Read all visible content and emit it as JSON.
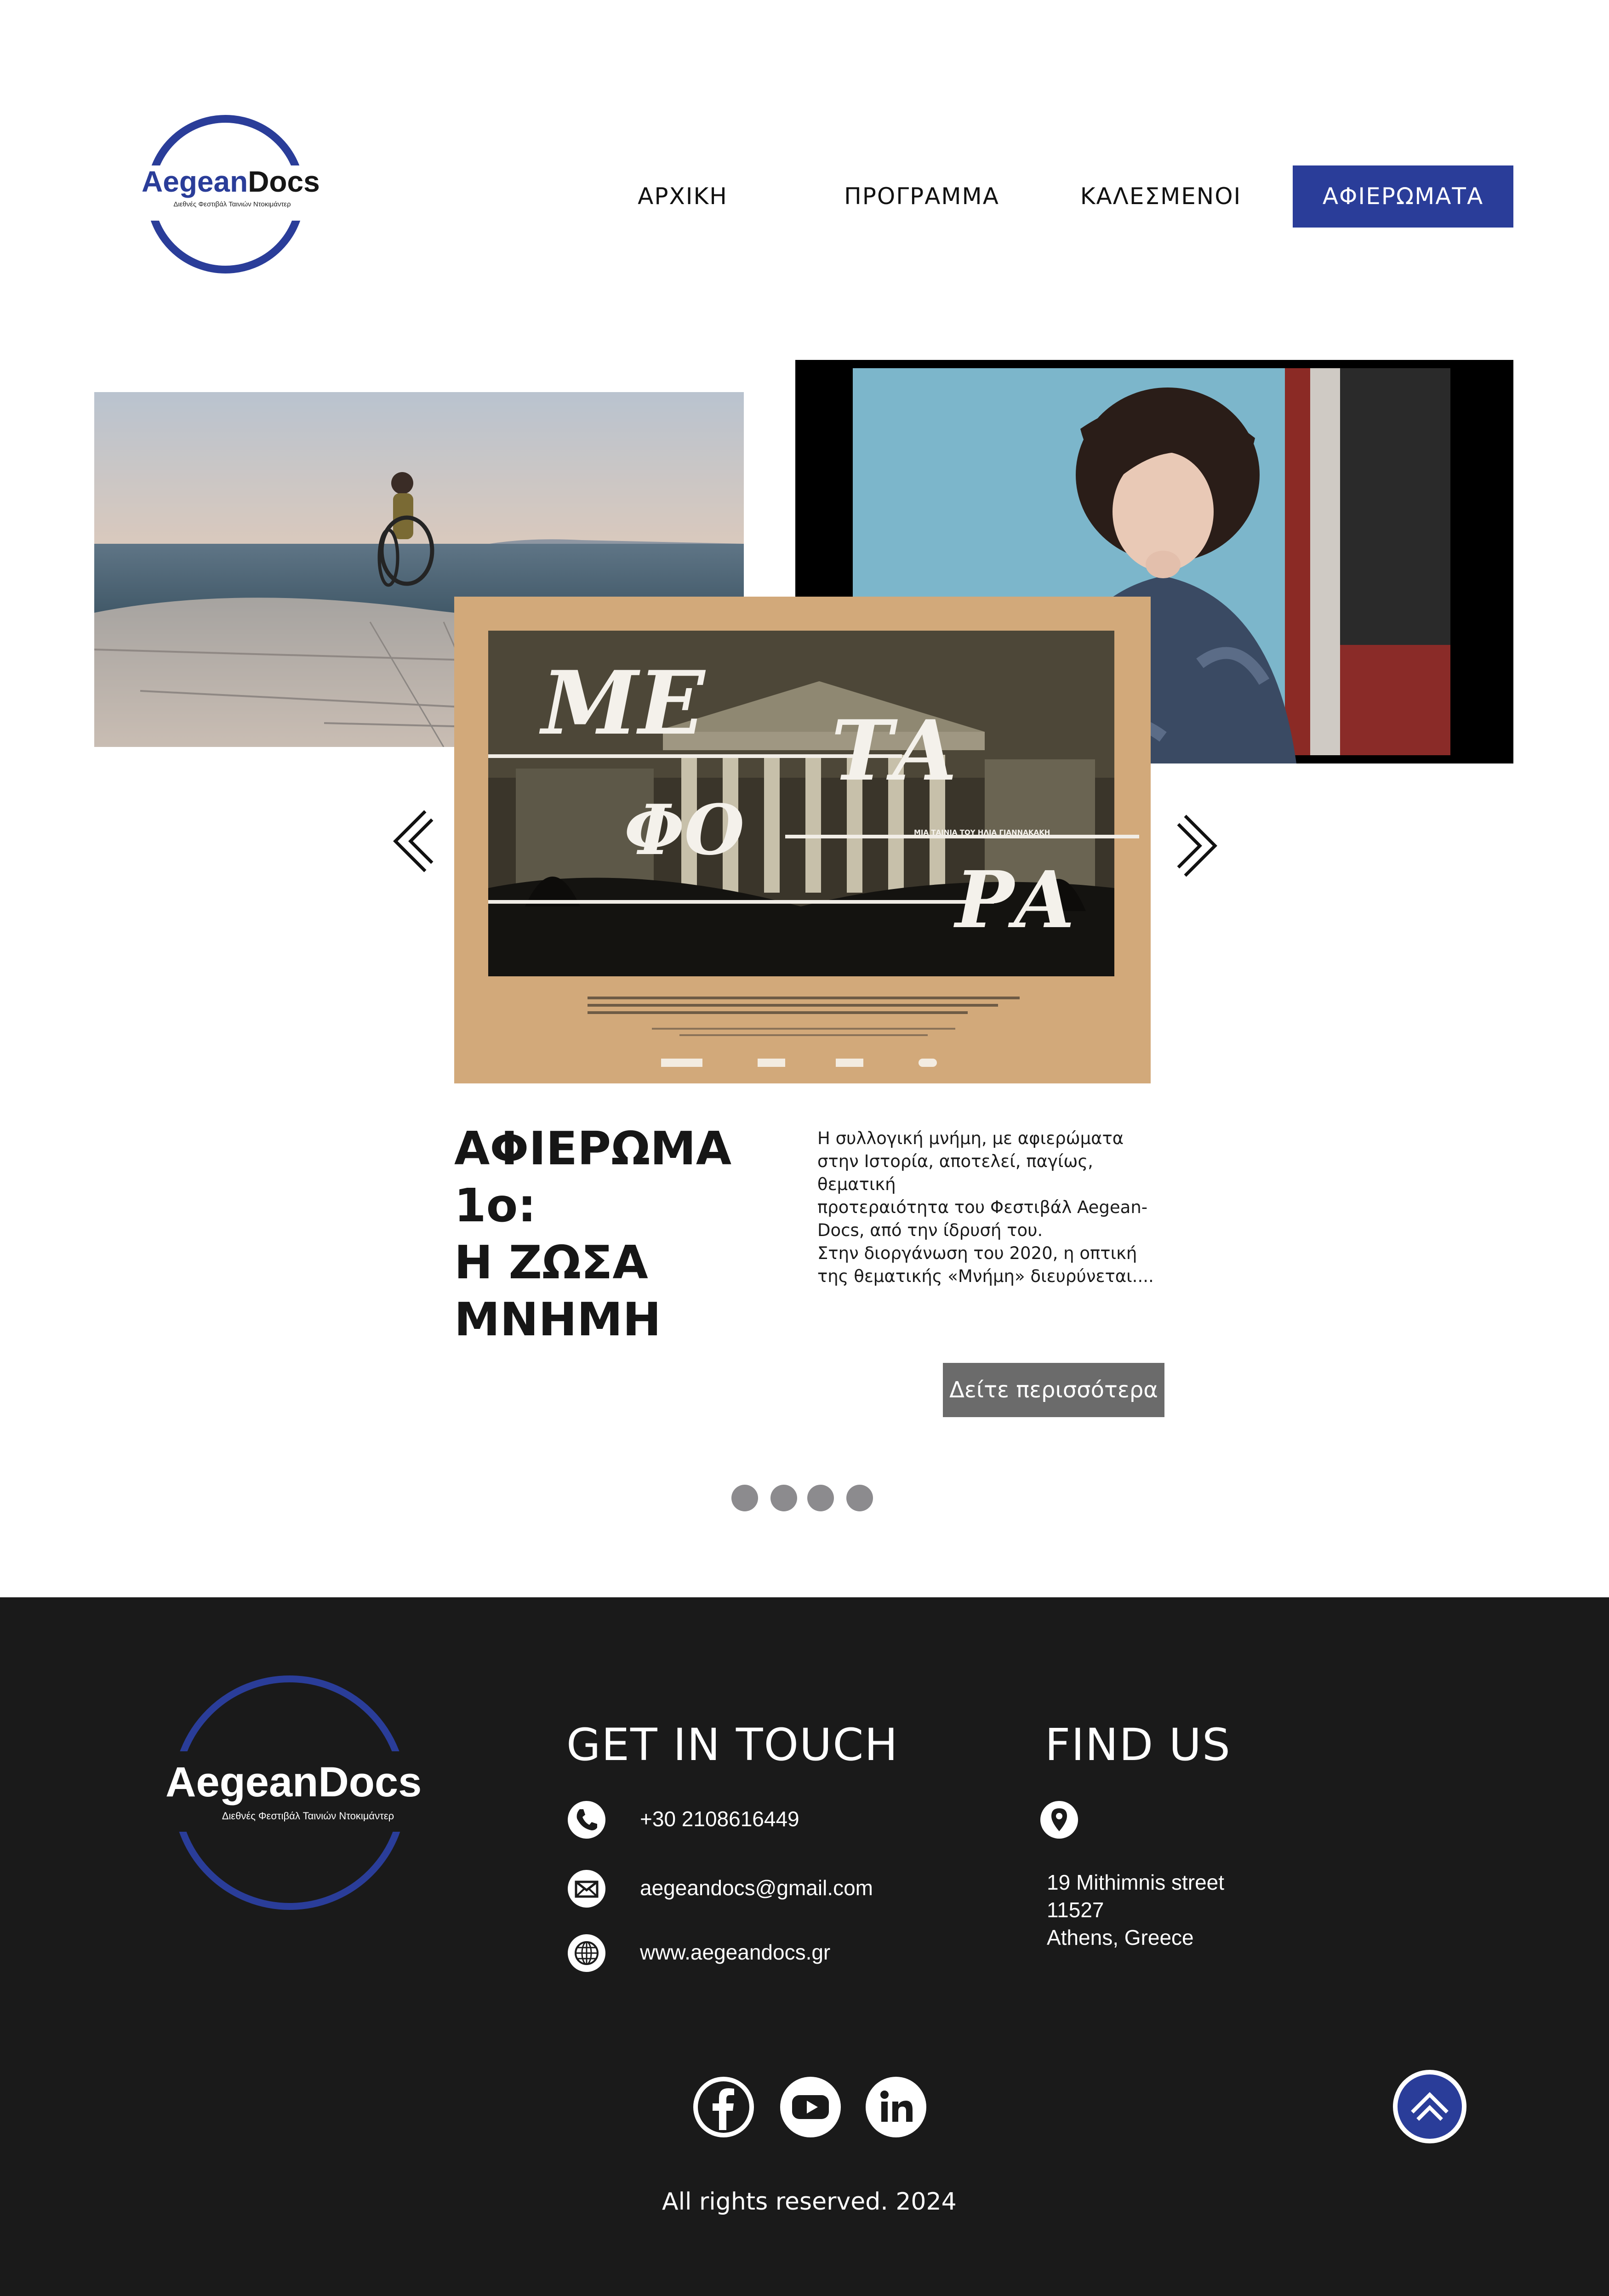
{
  "header": {
    "logo_text_1": "Aegean",
    "logo_text_2": "Docs",
    "logo_subtitle": "Διεθνές Φεστιβάλ Ταινιών Ντοκιμάντερ",
    "nav": [
      {
        "label": "ΑΡΧΙΚΗ",
        "active": false
      },
      {
        "label": "ΠΡΟΓΡΑΜΜΑ",
        "active": false
      },
      {
        "label": "ΚΑΛΕΣΜΕΝΟΙ",
        "active": false
      },
      {
        "label": "ΑΦΙΕΡΩΜΑΤΑ",
        "active": true
      }
    ]
  },
  "poster": {
    "word_1": "ΜΕ",
    "word_2": "ΤΑ",
    "word_3": "ΦΟ",
    "word_4": "ΡΑ",
    "tagline": "ΜΙΑ ΤΑΙΝΙΑ ΤΟΥ ΗΛΙΑ ΓΙΑΝΝΑΚΑΚΗ"
  },
  "feature": {
    "title_line_1": "ΑΦΙΕΡΩΜΑ 1ο:",
    "title_line_2": "Η ΖΩΣΑ",
    "title_line_3": "ΜΝΗΜΗ",
    "text_lines": [
      "Η συλλογική μνήμη, με αφιερώματα",
      "στην Ιστορία, αποτελεί, παγίως,",
      "θεματική",
      "προτεραιότητα του Φεστιβάλ Aegean-",
      "Docs, από την ίδρυσή του.",
      "Στην διοργάνωση του 2020, η οπτική",
      "της θεματικής «Μνήμη» διευρύνεται...."
    ],
    "more_label": "Δείτε περισσότερα"
  },
  "slider": {
    "dot_count": 4
  },
  "footer": {
    "logo_text": "AegeanDocs",
    "logo_subtitle": "Διεθνές Φεστιβάλ Ταινιών Ντοκιμάντερ",
    "contact_heading": "GET IN TOUCH",
    "phone": "+30 2108616449",
    "email": "aegeandocs@gmail.com",
    "website": "www.aegeandocs.gr",
    "find_heading": "FIND US",
    "address_line_1": "19 Mithimnis street",
    "address_line_2": "11527",
    "address_line_3": "Athens, Greece",
    "copyright": "All rights reserved. 2024",
    "socials": [
      "facebook-icon",
      "youtube-icon",
      "linkedin-icon"
    ]
  },
  "colors": {
    "brand_blue": "#2a3d99",
    "footer_bg": "#1a1a1a",
    "button_gray": "#6b6b6b",
    "poster_tan": "#d2a97a"
  }
}
